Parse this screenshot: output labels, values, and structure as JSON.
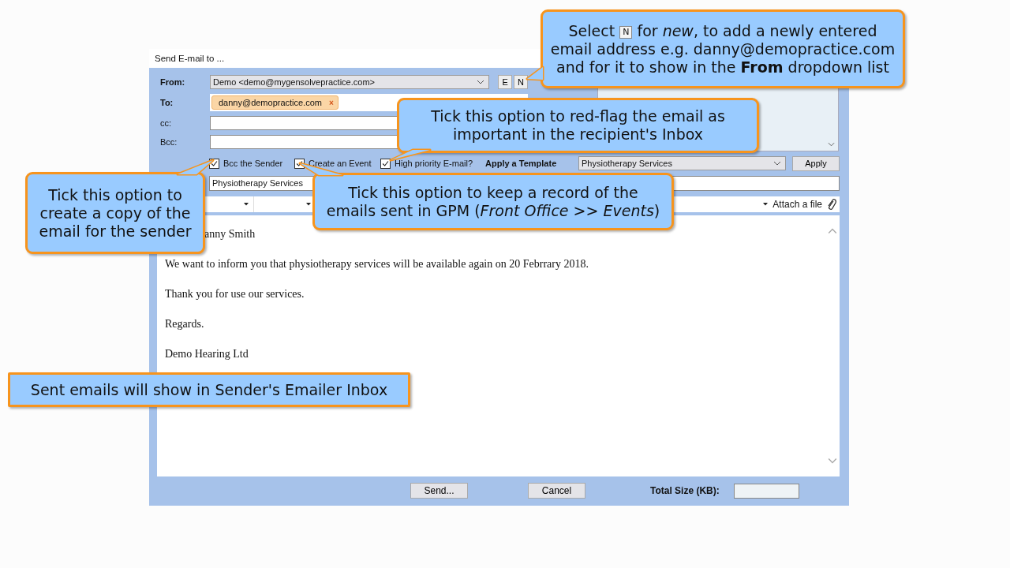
{
  "window": {
    "title": "Send E-mail to ..."
  },
  "form": {
    "from": {
      "label": "From:",
      "value": "Demo <demo@mygensolvepractice.com>",
      "buttons": [
        "E",
        "N"
      ]
    },
    "to": {
      "label": "To:",
      "recipients": [
        {
          "address": "danny@demopractice.com",
          "remove": "×"
        }
      ]
    },
    "cc": {
      "label": "cc:"
    },
    "bcc": {
      "label": "Bcc:"
    },
    "options": [
      {
        "label": "Bcc the Sender",
        "checked": true
      },
      {
        "label": "Create an Event",
        "checked": true
      },
      {
        "label": "High priority E-mail?",
        "checked": true
      }
    ],
    "template": {
      "label": "Apply a Template",
      "value": "Physiotherapy Services",
      "button": "Apply"
    },
    "subject": {
      "value": "Physiotherapy Services"
    },
    "toolbar": {
      "attach": "Attach a file"
    },
    "body": {
      "paragraphs": [
        "anny Smith",
        "We want to inform you that physiotherapy services will be available again on 20 Febrrary 2018.",
        "Thank you for use our services.",
        "Regards.",
        "Demo Hearing Ltd"
      ]
    },
    "footer": {
      "buttons": [
        "Send...",
        "Cancel"
      ],
      "total_size_label": "Total Size (KB):"
    }
  },
  "callouts": [
    {
      "before": "Select",
      "key": "N",
      "text": "for *new*, to add a newly entered email address e.g. danny@demopractice.com and for it to show in the **From** dropdown list"
    },
    {
      "text": "Tick this option to red-flag the email as important in the recipient's Inbox"
    },
    {
      "text": "Tick this option to create a copy of the email for the sender"
    },
    {
      "text": "Tick this option to keep a record of the emails sent in GPM (*Front Office* >> *Events*)"
    },
    {
      "text": "Sent emails will show in Sender's Emailer Inbox"
    }
  ]
}
